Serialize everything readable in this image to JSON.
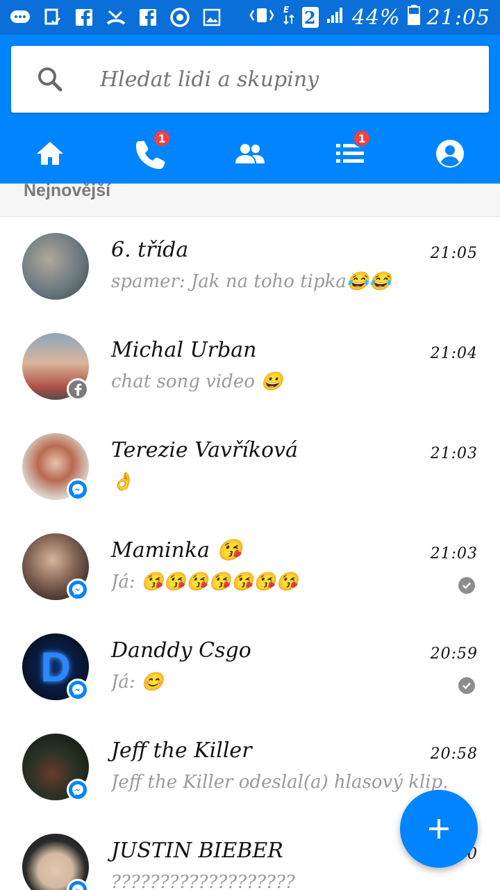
{
  "status_bar": {
    "battery": "44%",
    "time": "21:05",
    "sim": "2",
    "left_icons": [
      "messenger-icon",
      "clipboard-icon",
      "facebook-icon",
      "missed-call-icon",
      "facebook-icon",
      "opera-icon",
      "image-icon"
    ],
    "right_icons": [
      "vibrate-icon",
      "data-transfer-icon",
      "signal-icon",
      "battery-icon"
    ]
  },
  "search": {
    "placeholder": "Hledat lidi a skupiny"
  },
  "tabs": [
    {
      "icon": "home-icon",
      "active": true
    },
    {
      "icon": "phone-icon",
      "badge": "1"
    },
    {
      "icon": "people-icon"
    },
    {
      "icon": "list-icon",
      "badge": "1"
    },
    {
      "icon": "profile-icon"
    }
  ],
  "section": {
    "title": "Nejnovější"
  },
  "conversations": [
    {
      "name": "6. třída",
      "time": "21:05",
      "message": "spamer: Jak na toho tipka😂😂",
      "avatar_color": "#6c7a80",
      "badge": "none",
      "seen": false
    },
    {
      "name": "Michal Urban",
      "time": "21:04",
      "message": "chat song video 😀",
      "avatar_color": "#7a8fa0",
      "badge": "facebook",
      "seen": false
    },
    {
      "name": "Terezie Vavříková",
      "time": "21:03",
      "message": "👌",
      "avatar_color": "#c9a892",
      "badge": "messenger",
      "seen": false
    },
    {
      "name": "Maminka 😘",
      "time": "21:03",
      "message": "Já: 😘😘😘😘😘😘😘",
      "avatar_color": "#8a6a5a",
      "badge": "messenger",
      "seen": true
    },
    {
      "name": "Danddy Csgo",
      "time": "20:59",
      "message": "Já: 😊",
      "avatar_color": "#0a1a3a",
      "badge": "messenger",
      "seen": true
    },
    {
      "name": "Jeff the Killer",
      "time": "20:58",
      "message": "Jeff the Killer odeslal(a) hlasový klip.",
      "avatar_color": "#2c3326",
      "badge": "messenger",
      "seen": false
    },
    {
      "name": "JUSTIN BIEBER",
      "time": "20:50",
      "message": "???????????????????",
      "avatar_color": "#d1b8a0",
      "badge": "messenger",
      "seen": false
    }
  ],
  "fab": {
    "icon": "plus-icon"
  },
  "colors": {
    "header": "#0084ff",
    "status_bar": "#0a6fd9",
    "badge": "#fa3e3e"
  }
}
